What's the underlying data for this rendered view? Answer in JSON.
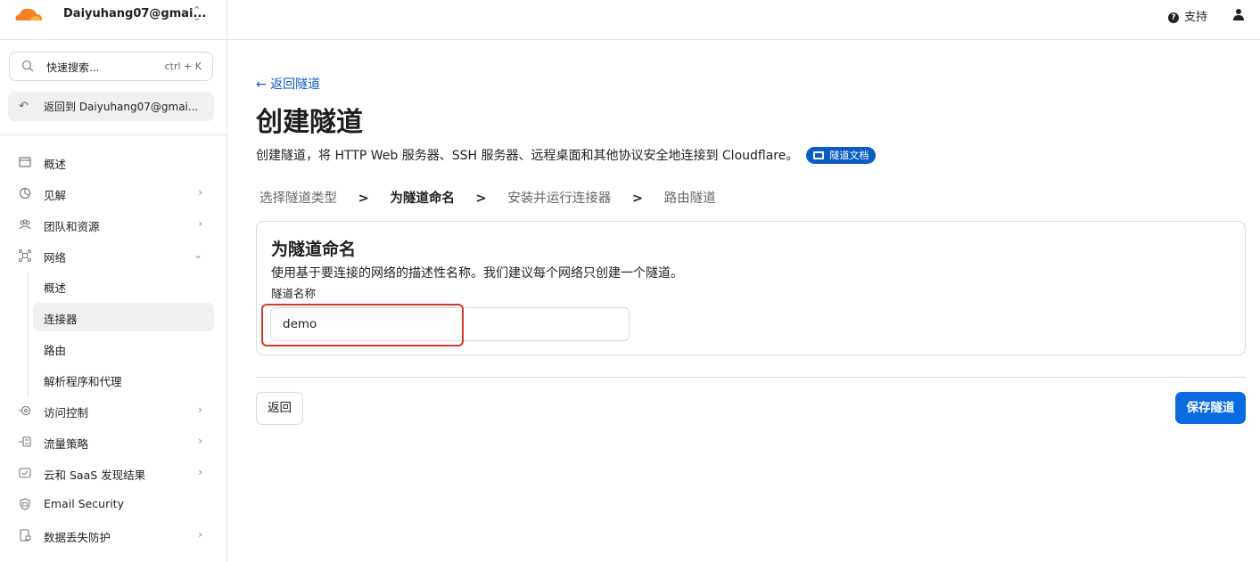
{
  "account": {
    "name": "Daiyuhang07@gmai...",
    "caret": "⌃⌄"
  },
  "search": {
    "placeholder": "快速搜索...",
    "shortcut": "ctrl + K"
  },
  "back_to_account": "返回到 Daiyuhang07@gmai...",
  "sidebar": {
    "items": [
      {
        "label": "概述",
        "icon": "window-icon",
        "chevron": ""
      },
      {
        "label": "见解",
        "icon": "chart-pie-icon",
        "chevron": "›"
      },
      {
        "label": "团队和资源",
        "icon": "people-icon",
        "chevron": "›"
      },
      {
        "label": "网络",
        "icon": "network-icon",
        "chevron": "⌄"
      },
      {
        "label": "访问控制",
        "icon": "access-icon",
        "chevron": "›"
      },
      {
        "label": "流量策略",
        "icon": "traffic-icon",
        "chevron": "›"
      },
      {
        "label": "云和 SaaS 发现结果",
        "icon": "cloud-check-icon",
        "chevron": "›"
      },
      {
        "label": "Email Security",
        "icon": "email-shield-icon",
        "chevron": ""
      },
      {
        "label": "数据丢失防护",
        "icon": "data-lock-icon",
        "chevron": "›"
      }
    ],
    "subitems": [
      {
        "label": "概述"
      },
      {
        "label": "连接器"
      },
      {
        "label": "路由"
      },
      {
        "label": "解析程序和代理"
      }
    ]
  },
  "topbar": {
    "support_label": "支持"
  },
  "main": {
    "back_link": "← 返回隧道",
    "title": "创建隧道",
    "description": "创建隧道，将 HTTP Web 服务器、SSH 服务器、远程桌面和其他协议安全地连接到 Cloudflare。",
    "doc_badge": "隧道文档",
    "steps": [
      "选择隧道类型",
      "为隧道命名",
      "安装并运行连接器",
      "路由隧道"
    ],
    "step_separator": ">",
    "card": {
      "title": "为隧道命名",
      "subtitle": "使用基于要连接的网络的描述性名称。我们建议每个网络只创建一个隧道。",
      "field_label": "隧道名称",
      "field_value": "demo"
    },
    "back_button": "返回",
    "save_button": "保存隧道"
  },
  "colors": {
    "accent": "#0a6be0",
    "link": "#0a5dc2",
    "highlight": "#d63a2a",
    "logo": "#f48120"
  }
}
